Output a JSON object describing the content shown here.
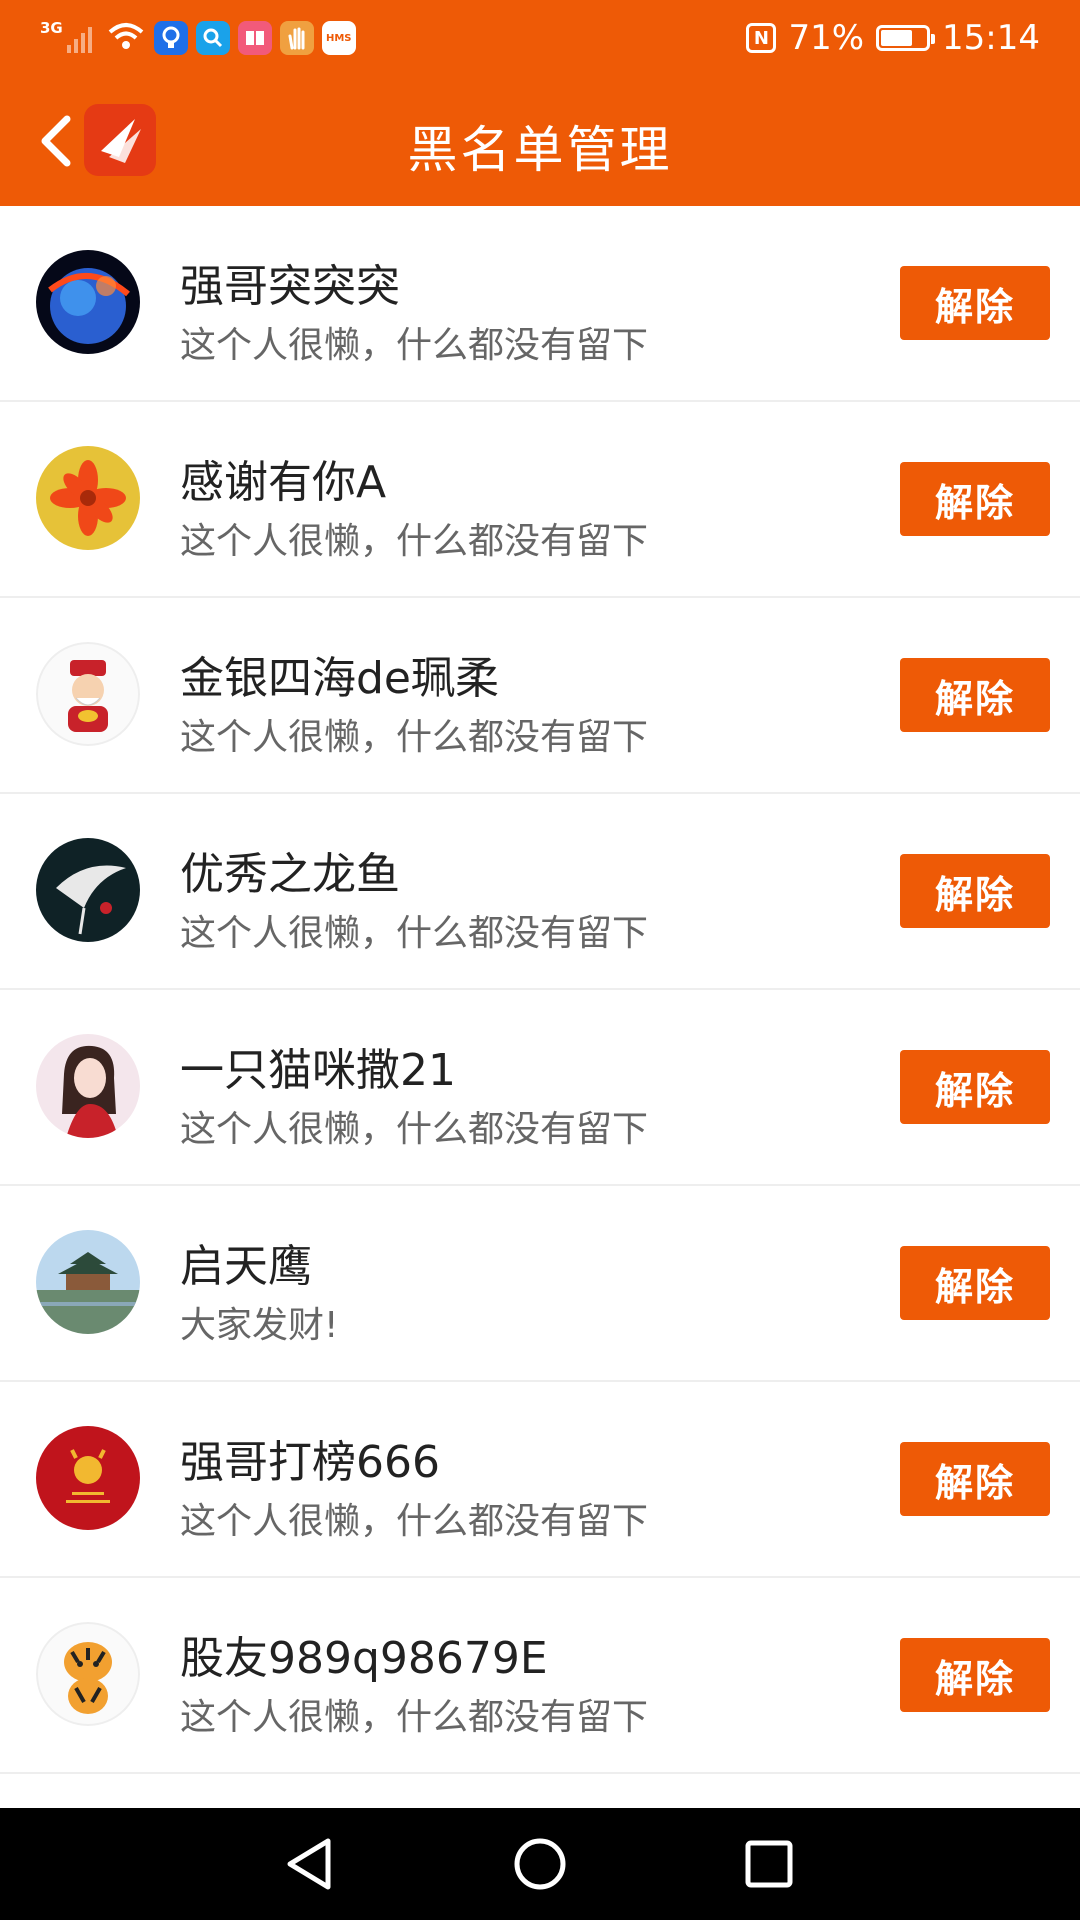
{
  "status_bar": {
    "network": "3G",
    "nfc_label": "N",
    "battery_text": "71%",
    "battery_level": 0.71,
    "time": "15:14",
    "notification_icons": [
      "bulb-app-icon",
      "search-app-icon",
      "book-app-icon",
      "hand-app-icon",
      "hms-app-icon"
    ],
    "hms_label": "HMS"
  },
  "header": {
    "title": "黑名单管理"
  },
  "colors": {
    "brand": "#ee5a06",
    "text_primary": "#222222",
    "text_secondary": "#666666",
    "divider": "#eeeeee"
  },
  "blacklist": [
    {
      "name": "强哥突突突",
      "signature": "这个人很懒，什么都没有留下",
      "button": "解除"
    },
    {
      "name": "感谢有你A",
      "signature": "这个人很懒，什么都没有留下",
      "button": "解除"
    },
    {
      "name": "金银四海de珮柔",
      "signature": "这个人很懒，什么都没有留下",
      "button": "解除"
    },
    {
      "name": "优秀之龙鱼",
      "signature": "这个人很懒，什么都没有留下",
      "button": "解除"
    },
    {
      "name": "一只猫咪撒21",
      "signature": "这个人很懒，什么都没有留下",
      "button": "解除"
    },
    {
      "name": "启天鹰",
      "signature": "大家发财!",
      "button": "解除"
    },
    {
      "name": "强哥打榜666",
      "signature": "这个人很懒，什么都没有留下",
      "button": "解除"
    },
    {
      "name": "股友989q98679E",
      "signature": "这个人很懒，什么都没有留下",
      "button": "解除"
    }
  ],
  "nav": {
    "back_icon": "triangle-back-icon",
    "home_icon": "circle-home-icon",
    "recents_icon": "square-recents-icon"
  }
}
